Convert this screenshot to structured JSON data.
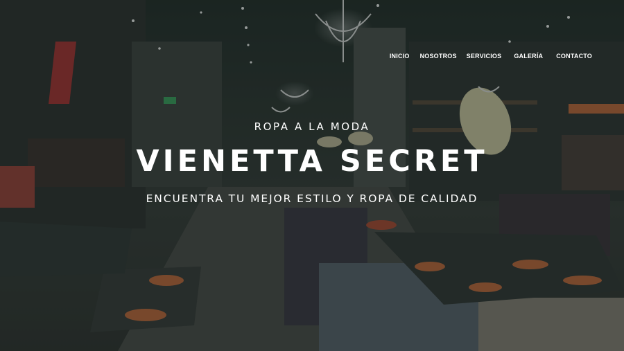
{
  "nav": {
    "items": [
      {
        "label": "INICIO"
      },
      {
        "label": "NOSOTROS"
      },
      {
        "label": "SERVICIOS"
      },
      {
        "label": "GALERÍA"
      },
      {
        "label": "CONTACTO"
      }
    ]
  },
  "hero": {
    "tagline": "ROPA A LA MODA",
    "title": "VIENETTA SECRET",
    "subtitle": "ENCUENTRA TU MEJOR ESTILO Y ROPA DE CALIDAD",
    "background": "store-interior-photo"
  },
  "colors": {
    "overlay": "#16201c",
    "text": "#ffffff"
  }
}
